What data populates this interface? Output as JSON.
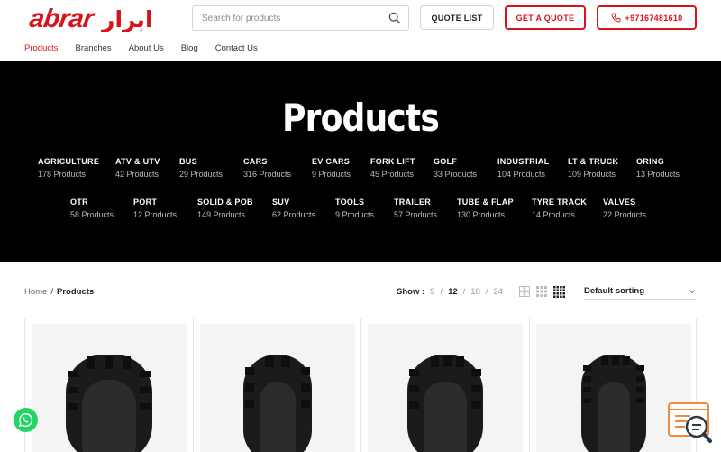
{
  "brand": {
    "logo_latin": "abrar",
    "logo_arabic": "ابرار"
  },
  "search": {
    "placeholder": "Search for products"
  },
  "header": {
    "quote_list": "QUOTE LIST",
    "get_quote": "GET A QUOTE",
    "phone": "+97167481610"
  },
  "nav": {
    "items": [
      {
        "label": "Products"
      },
      {
        "label": "Branches"
      },
      {
        "label": "About Us"
      },
      {
        "label": "Blog"
      },
      {
        "label": "Contact Us"
      }
    ]
  },
  "hero": {
    "title": "Products",
    "categories": [
      {
        "name": "AGRICULTURE",
        "count": "178 Products"
      },
      {
        "name": "ATV & UTV",
        "count": "42 Products"
      },
      {
        "name": "BUS",
        "count": "29 Products"
      },
      {
        "name": "CARS",
        "count": "316 Products"
      },
      {
        "name": "EV CARS",
        "count": "9 Products"
      },
      {
        "name": "FORK LIFT",
        "count": "45 Products"
      },
      {
        "name": "GOLF",
        "count": "33 Products"
      },
      {
        "name": "INDUSTRIAL",
        "count": "104 Products"
      },
      {
        "name": "LT & TRUCK",
        "count": "109 Products"
      },
      {
        "name": "ORING",
        "count": "13 Products"
      },
      {
        "name": "OTR",
        "count": "58 Products"
      },
      {
        "name": "PORT",
        "count": "12 Products"
      },
      {
        "name": "SOLID & POB",
        "count": "149 Products"
      },
      {
        "name": "SUV",
        "count": "62 Products"
      },
      {
        "name": "TOOLS",
        "count": "9 Products"
      },
      {
        "name": "TRAILER",
        "count": "57 Products"
      },
      {
        "name": "TUBE & FLAP",
        "count": "130 Products"
      },
      {
        "name": "TYRE TRACK",
        "count": "14 Products"
      },
      {
        "name": "VALVES",
        "count": "22 Products"
      }
    ]
  },
  "breadcrumb": {
    "home": "Home",
    "separator": "/",
    "current": "Products"
  },
  "show": {
    "label": "Show :",
    "options": [
      "9",
      "12",
      "18",
      "24"
    ],
    "selected": "12",
    "separator": "/"
  },
  "sort": {
    "selected": "Default sorting"
  },
  "icons": {
    "search": "search-icon",
    "phone": "phone-icon",
    "grid_2": "grid-2-columns-icon",
    "grid_3": "grid-3-columns-icon",
    "grid_4": "grid-4-columns-icon",
    "chevron": "chevron-down-icon",
    "whatsapp": "whatsapp-icon",
    "support": "search-support-icon"
  },
  "colors": {
    "brand_red": "#d8141b",
    "hero_bg": "#000000",
    "whatsapp": "#25d366",
    "support_orange": "#f08a3c"
  }
}
